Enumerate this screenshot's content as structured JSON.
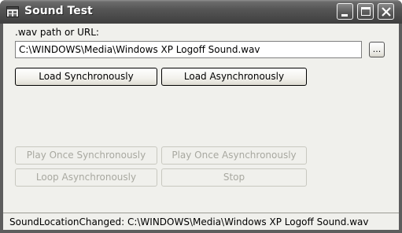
{
  "window": {
    "title": "Sound Test",
    "controls": {
      "minimize": "minimize-icon",
      "maximize": "maximize-icon",
      "close": "close-icon"
    }
  },
  "form": {
    "path_label": ".wav path or URL:",
    "path_value": "C:\\WINDOWS\\Media\\Windows XP Logoff Sound.wav",
    "browse_label": "..."
  },
  "buttons": {
    "load_sync": "Load Synchronously",
    "load_async": "Load Asynchronously",
    "play_once_sync": "Play Once Synchronously",
    "play_once_async": "Play Once Asynchronously",
    "loop_async": "Loop Asynchronously",
    "stop": "Stop"
  },
  "status": {
    "text": "SoundLocationChanged: C:\\WINDOWS\\Media\\Windows XP Logoff Sound.wav"
  },
  "colors": {
    "titlebar": "#4a4a4a",
    "client_bg": "#f0f0ec",
    "disabled_text": "#a8a8a0"
  }
}
